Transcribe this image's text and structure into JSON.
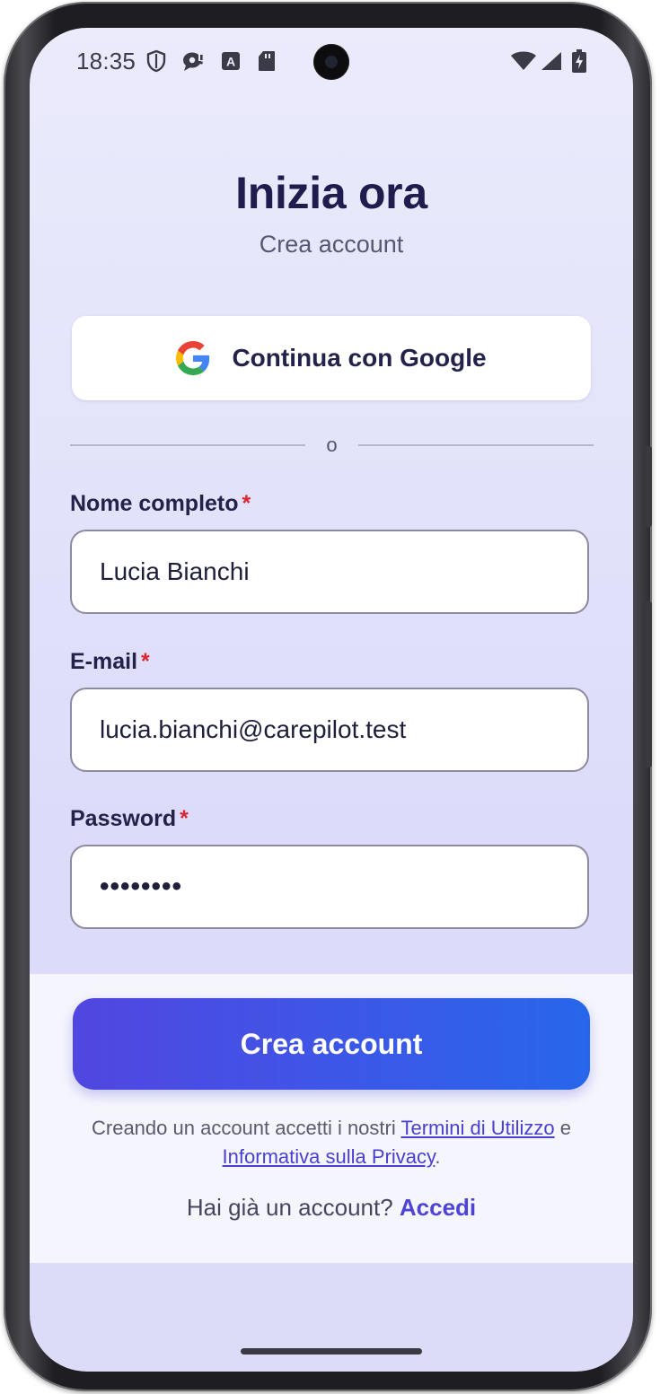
{
  "status_bar": {
    "time": "18:35",
    "left_icons": [
      "shield-icon",
      "chat-alert-icon",
      "text-a-icon",
      "sd-card-icon"
    ],
    "right_icons": [
      "wifi-icon",
      "signal-icon",
      "battery-charging-icon"
    ]
  },
  "header": {
    "title": "Inizia ora",
    "subtitle": "Crea account"
  },
  "google_button": {
    "label": "Continua con Google",
    "icon": "google-logo-icon"
  },
  "divider_text": "o",
  "form": {
    "name": {
      "label": "Nome completo",
      "required_mark": "*",
      "value": "Lucia Bianchi"
    },
    "email": {
      "label": "E-mail",
      "required_mark": "*",
      "value": "lucia.bianchi@carepilot.test"
    },
    "password": {
      "label": "Password",
      "required_mark": "*",
      "value": "••••••••"
    }
  },
  "submit_button": {
    "label": "Crea account"
  },
  "terms": {
    "prefix": "Creando un account accetti i nostri ",
    "terms_link": "Termini di Utilizzo",
    "middle": " e ",
    "privacy_link": "Informativa sulla Privacy",
    "suffix": "."
  },
  "login": {
    "prompt": "Hai già un account? ",
    "link": "Accedi"
  },
  "colors": {
    "accent": "#4f43d6",
    "cta_gradient_start": "#5146e0",
    "cta_gradient_end": "#2766ea",
    "required": "#d8262f",
    "title": "#1f1d4d"
  }
}
